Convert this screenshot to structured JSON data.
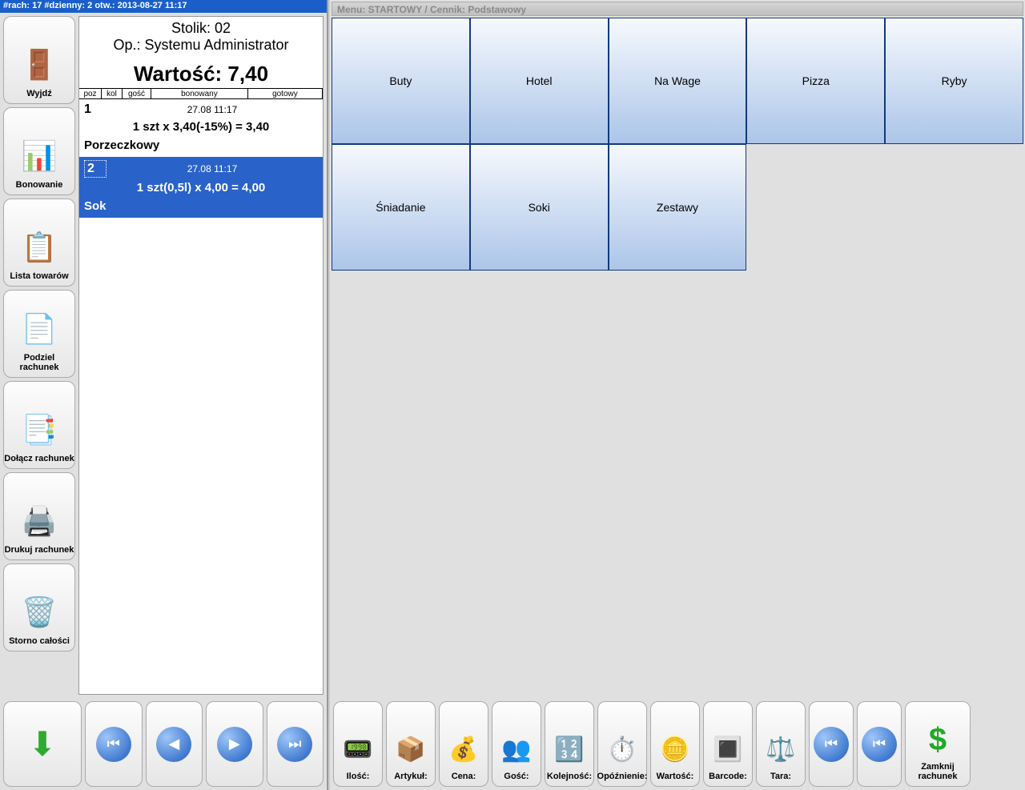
{
  "status": "#rach: 17 #dzienny: 2 otw.: 2013-08-27 11:17",
  "sidebar": {
    "items": [
      {
        "label": "Wyjdź",
        "icon": "🚪"
      },
      {
        "label": "Bonowanie",
        "icon": "📊"
      },
      {
        "label": "Lista towarów",
        "icon": "📋"
      },
      {
        "label": "Podziel rachunek",
        "icon": "📄"
      },
      {
        "label": "Dołącz rachunek",
        "icon": "📑"
      },
      {
        "label": "Drukuj rachunek",
        "icon": "🖨️"
      },
      {
        "label": "Storno całości",
        "icon": "🗑️"
      }
    ]
  },
  "order": {
    "table": "Stolik: 02",
    "operator": "Op.: Systemu Administrator",
    "total_label": "Wartość: 7,40",
    "cols": {
      "poz": "poz",
      "kol": "kol",
      "gosc": "gość",
      "bon": "bonowany",
      "got": "gotowy"
    },
    "items": [
      {
        "num": "1",
        "ts": "27.08 11:17",
        "calc": "1 szt x 3,40(-15%) = 3,40",
        "name": "Porzeczkowy",
        "selected": false
      },
      {
        "num": "2",
        "ts": "27.08 11:17",
        "calc": "1 szt(0,5l) x 4,00 = 4,00",
        "name": "Sok",
        "selected": true
      }
    ]
  },
  "menu": {
    "title": "Menu: STARTOWY / Cennik: Podstawowy",
    "items": [
      "Buty",
      "Hotel",
      "Na Wage",
      "Pizza",
      "Ryby",
      "Śniadanie",
      "Soki",
      "Zestawy"
    ]
  },
  "tools": {
    "items": [
      {
        "label": "Ilość:",
        "icon": "📟"
      },
      {
        "label": "Artykuł:",
        "icon": "📦"
      },
      {
        "label": "Cena:",
        "icon": "💰"
      },
      {
        "label": "Gość:",
        "icon": "👥"
      },
      {
        "label": "Kolejność:",
        "icon": "🔢"
      },
      {
        "label": "Opóźnienie:",
        "icon": "⏱️"
      },
      {
        "label": "Wartość:",
        "icon": "🪙"
      },
      {
        "label": "Barcode:",
        "icon": "🔳"
      },
      {
        "label": "Tara:",
        "icon": "⚖️"
      }
    ],
    "close_label": "Zamknij rachunek"
  }
}
